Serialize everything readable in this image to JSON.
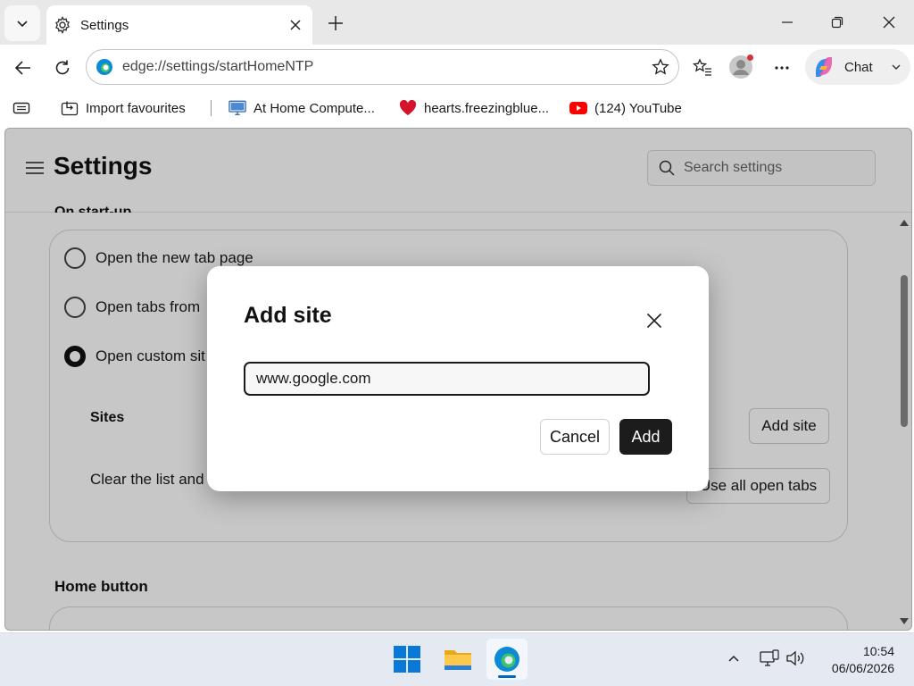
{
  "browser": {
    "tab": {
      "title": "Settings"
    },
    "address": {
      "url": "edge://settings/startHomeNTP"
    },
    "chat_label": "Chat",
    "favourites": [
      {
        "label": "Import favourites",
        "icon": "import-icon"
      },
      {
        "label": "At Home Compute...",
        "icon": "computer-icon"
      },
      {
        "label": "hearts.freezingblue...",
        "icon": "heart-icon"
      },
      {
        "label": "(124) YouTube",
        "icon": "youtube-icon"
      }
    ]
  },
  "settings": {
    "title": "Settings",
    "search_placeholder": "Search settings",
    "startup": {
      "partial_heading": "On start-up",
      "options": [
        {
          "label": "Open the new tab page",
          "checked": false
        },
        {
          "label": "Open tabs from",
          "checked": false
        },
        {
          "label": "Open custom sit",
          "checked": true
        }
      ],
      "sites_label": "Sites",
      "add_site_button": "Add site",
      "clear_text": "Clear the list and",
      "use_open_tabs_button": "Use all open tabs"
    },
    "home_button_heading": "Home button"
  },
  "dialog": {
    "title": "Add site",
    "input_value": "www.google.com",
    "cancel_label": "Cancel",
    "add_label": "Add"
  },
  "taskbar": {
    "time": "10:54",
    "date": "06/06/2026"
  },
  "colors": {
    "accent": "#0067c0",
    "primary_button": "#1c1c1c",
    "youtube_red": "#ff0000",
    "notification_dot": "#d13438"
  }
}
